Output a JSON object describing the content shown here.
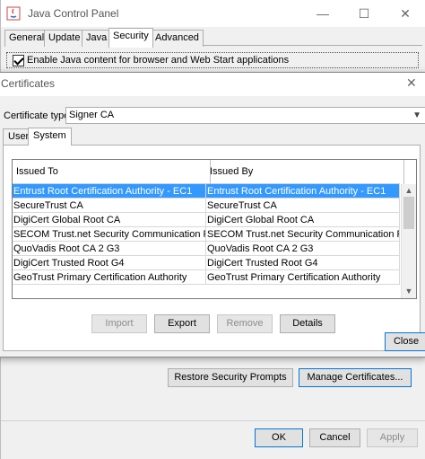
{
  "main": {
    "title": "Java Control Panel",
    "window_controls": {
      "minimize": "—",
      "maximize": "☐",
      "close": "✕"
    },
    "tabs": [
      "General",
      "Update",
      "Java",
      "Security",
      "Advanced"
    ],
    "active_tab": "Security",
    "enable_java_label": "Enable Java content for browser and Web Start applications",
    "restore_button": "Restore Security Prompts",
    "manage_button": "Manage Certificates...",
    "ok": "OK",
    "cancel": "Cancel",
    "apply": "Apply"
  },
  "cert": {
    "title": "Certificates",
    "close_glyph": "✕",
    "type_label": "Certificate type:",
    "type_value": "Signer CA",
    "subtabs": [
      "User",
      "System"
    ],
    "active_subtab": "System",
    "columns": [
      "Issued To",
      "Issued By"
    ],
    "rows": [
      [
        "Entrust Root Certification Authority - EC1",
        "Entrust Root Certification Authority - EC1"
      ],
      [
        "SecureTrust CA",
        "SecureTrust CA"
      ],
      [
        "DigiCert Global Root CA",
        "DigiCert Global Root CA"
      ],
      [
        "SECOM Trust.net Security Communication Roo...",
        "SECOM Trust.net Security Communication Roo..."
      ],
      [
        "QuoVadis Root CA 2 G3",
        "QuoVadis Root CA 2 G3"
      ],
      [
        "DigiCert Trusted Root G4",
        "DigiCert Trusted Root G4"
      ],
      [
        "GeoTrust Primary Certification Authority",
        "GeoTrust Primary Certification Authority"
      ]
    ],
    "buttons": {
      "import": "Import",
      "export": "Export",
      "remove": "Remove",
      "details": "Details"
    },
    "close_button": "Close"
  },
  "colors": {
    "selection": "#3399ff",
    "focus_border": "#0078d7"
  }
}
